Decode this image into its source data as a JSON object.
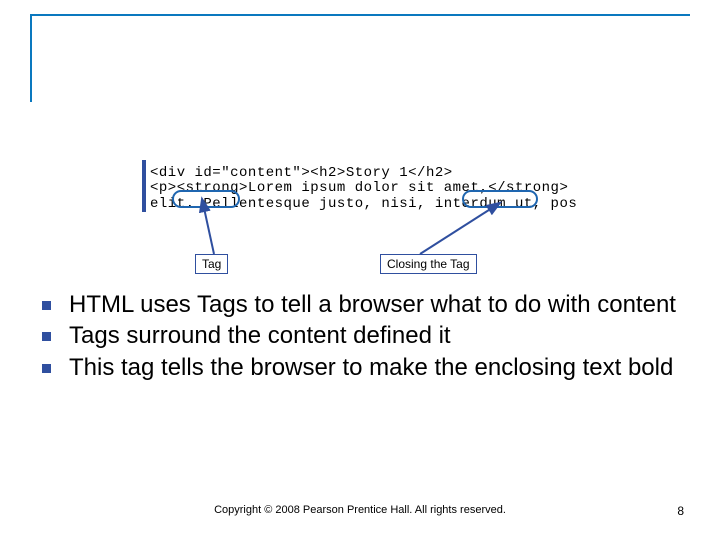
{
  "code": {
    "line0": "<div id=\"content\"><h2>Story 1</h2>",
    "line1": "<p><strong>Lorem ipsum dolor sit amet,</strong> co",
    "line2": "elit. Pellentesque justo, nisi, interdum ut, posue"
  },
  "callouts": {
    "tag": "Tag",
    "closing": "Closing the Tag"
  },
  "bullets": [
    "HTML uses Tags to tell a browser what to do with content",
    "Tags surround the content defined it",
    "This tag tells the browser to make the enclosing text bold"
  ],
  "footer": "Copyright © 2008 Pearson Prentice Hall. All rights reserved.",
  "page": "8"
}
